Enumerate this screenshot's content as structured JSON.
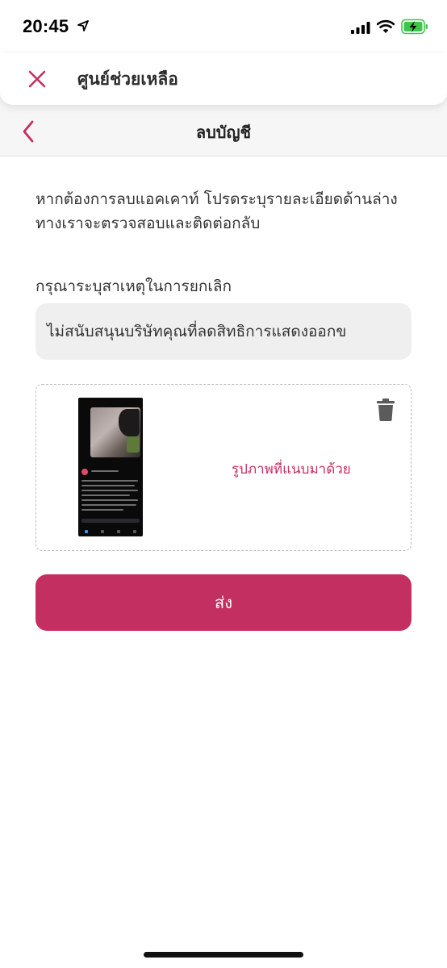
{
  "status_bar": {
    "time": "20:45",
    "icons": [
      "location-arrow-icon",
      "signal-bars-icon",
      "wifi-icon",
      "battery-charging-icon"
    ],
    "battery_color": "#3ec64b"
  },
  "help_header": {
    "title": "ศูนย์ช่วยเหลือ",
    "close_icon": "close-icon"
  },
  "nav": {
    "title": "ลบบัญชี",
    "back_icon": "chevron-left-icon"
  },
  "form": {
    "intro": "หากต้องการลบแอคเคาท์ โปรดระบุรายละเอียดด้านล่าง ทางเราจะตรวจสอบและติดต่อกลับ",
    "reason_label": "กรุณาระบุสาเหตุในการยกเลิก",
    "reason_value": "ไม่สนับสนุนบริษัทคุณที่ลดสิทธิการแสดงออกข",
    "attachment_label": "รูปภาพที่แนบมาด้วย",
    "delete_icon": "trash-icon",
    "submit_label": "ส่ง"
  },
  "colors": {
    "accent": "#c42f62",
    "input_bg": "#efeff0",
    "band_bg": "#f6f6f7"
  }
}
